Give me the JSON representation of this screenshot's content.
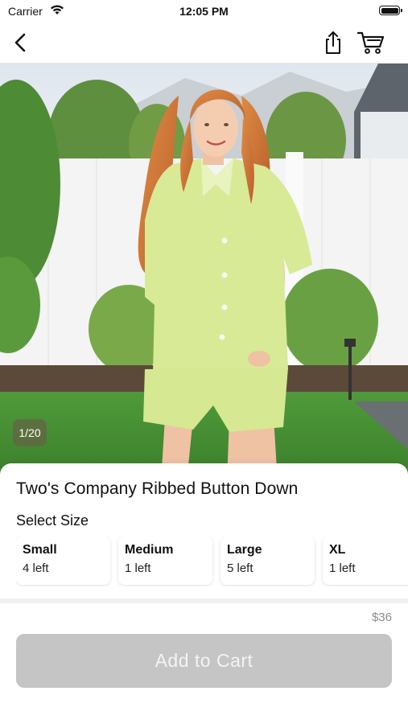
{
  "status_bar": {
    "carrier": "Carrier",
    "time": "12:05 PM"
  },
  "nav": {
    "icons": [
      "chevron-left-icon",
      "share-icon",
      "cart-icon"
    ]
  },
  "gallery": {
    "counter": "1/20"
  },
  "product": {
    "title": "Two's Company Ribbed Button Down",
    "size_label": "Select Size",
    "sizes": [
      {
        "name": "Small",
        "stock": "4 left"
      },
      {
        "name": "Medium",
        "stock": "1 left"
      },
      {
        "name": "Large",
        "stock": "5 left"
      },
      {
        "name": "XL",
        "stock": "1 left"
      }
    ],
    "price": "$36",
    "add_to_cart": "Add to Cart"
  },
  "colors": {
    "button_disabled": "#c5c5c5",
    "top_fabric": "#d8ea96"
  }
}
